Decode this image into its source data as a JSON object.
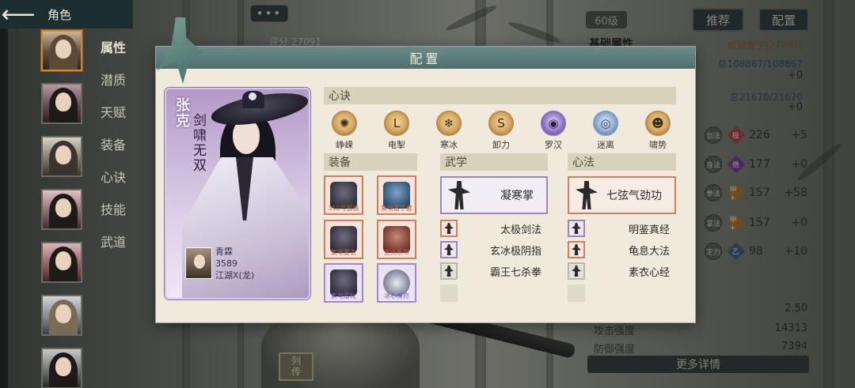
{
  "header": {
    "title": "角色"
  },
  "sidebar": {
    "menu": [
      "属性",
      "潜质",
      "天赋",
      "装备",
      "心诀",
      "技能",
      "武道"
    ]
  },
  "top": {
    "chat_label": "•••",
    "score": "评分 27091",
    "level": "60级",
    "recommend_label": "推荐",
    "config_label": "配置"
  },
  "right_panel": {
    "basic_title": "基础属性",
    "power": "威镇寰宇(27091)",
    "hp": "总108867/108867",
    "hp_delta": "+0",
    "mp": "总21670/21670",
    "mp_delta": "+0",
    "attributes": [
      {
        "icon": "剑法",
        "tag": "极",
        "value": "226",
        "delta": "+5",
        "color": "#b33a4a"
      },
      {
        "icon": "身法",
        "tag": "绝",
        "value": "177",
        "delta": "+0",
        "color": "#7b3a9a"
      },
      {
        "icon": "拳法",
        "tag": "甲+",
        "value": "157",
        "delta": "+58",
        "color": "#b8742e"
      },
      {
        "icon": "掌法",
        "tag": "甲+",
        "value": "157",
        "delta": "+0",
        "color": "#b8742e"
      },
      {
        "icon": "定力",
        "tag": "乙",
        "value": "98",
        "delta": "+10",
        "color": "#3b5e8c"
      }
    ],
    "crit": "2.50",
    "atk_label": "攻击强度",
    "atk": "14313",
    "def_label": "防御强度",
    "def": "7394",
    "more_label": "更多详情",
    "legend_label": "列传"
  },
  "modal": {
    "title": "配置",
    "character": {
      "name": "张克",
      "title": "剑啸无双",
      "owner_name": "青霖",
      "owner_score": "3589",
      "owner_server": "江湖X(龙)"
    },
    "xinjue_title": "心诀",
    "xinjue": [
      {
        "label": "峥嵘",
        "glyph": "✺",
        "tone": "gold"
      },
      {
        "label": "电掣",
        "glyph": "L",
        "tone": "gold"
      },
      {
        "label": "寒冰",
        "glyph": "❄",
        "tone": "gold"
      },
      {
        "label": "卸力",
        "glyph": "S",
        "tone": "gold"
      },
      {
        "label": "罗汉",
        "glyph": "◉",
        "tone": "purple"
      },
      {
        "label": "迷离",
        "glyph": "◎",
        "tone": "blue"
      },
      {
        "label": "啸势",
        "glyph": "☻",
        "tone": "gold"
      }
    ],
    "equip_title": "装备",
    "equipment": [
      {
        "name": "310号服装",
        "style": "",
        "tone": "orange"
      },
      {
        "name": "紫电雷手套",
        "style": "blue",
        "tone": "orange"
      },
      {
        "name": "紫电雷衣",
        "style": "",
        "tone": "orange"
      },
      {
        "name": "金火系带",
        "style": "red",
        "tone": "orange"
      },
      {
        "name": "紫电雷靴",
        "style": "",
        "tone": "purple"
      },
      {
        "name": "冰心魔符",
        "style": "ring",
        "tone": "purple"
      }
    ],
    "wuxue_title": "武学",
    "wuxue_main": "凝寒掌",
    "wuxue": [
      "太极剑法",
      "玄冰极阴指",
      "霸王七杀拳"
    ],
    "xinfa_title": "心法",
    "xinfa_main": "七弦气劲功",
    "xinfa": [
      "明鉴真经",
      "龟息大法",
      "素衣心经"
    ]
  }
}
